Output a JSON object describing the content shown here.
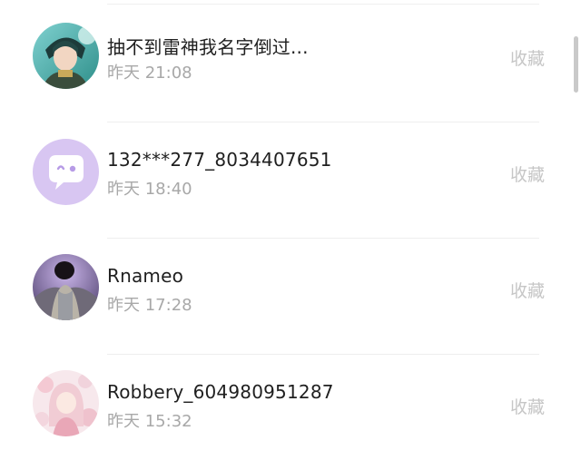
{
  "items": [
    {
      "name": "抽不到雷神我名字倒过...",
      "time": "昨天 21:08",
      "action": "收藏",
      "avatar_icon": "anime-boy-avatar"
    },
    {
      "name": "132***277_8034407651",
      "time": "昨天 18:40",
      "action": "收藏",
      "avatar_icon": "default-chat-bubble-avatar"
    },
    {
      "name": "Rnameo",
      "time": "昨天 17:28",
      "action": "收藏",
      "avatar_icon": "photo-avatar"
    },
    {
      "name": "Robbery_604980951287",
      "time": "昨天 15:32",
      "action": "收藏",
      "avatar_icon": "pink-anime-girl-avatar"
    }
  ],
  "colors": {
    "name_text": "#1f1f1f",
    "time_text": "#a8a8a8",
    "action_text": "#c6c6c6",
    "default_avatar_bg": "#d8c6f2"
  }
}
